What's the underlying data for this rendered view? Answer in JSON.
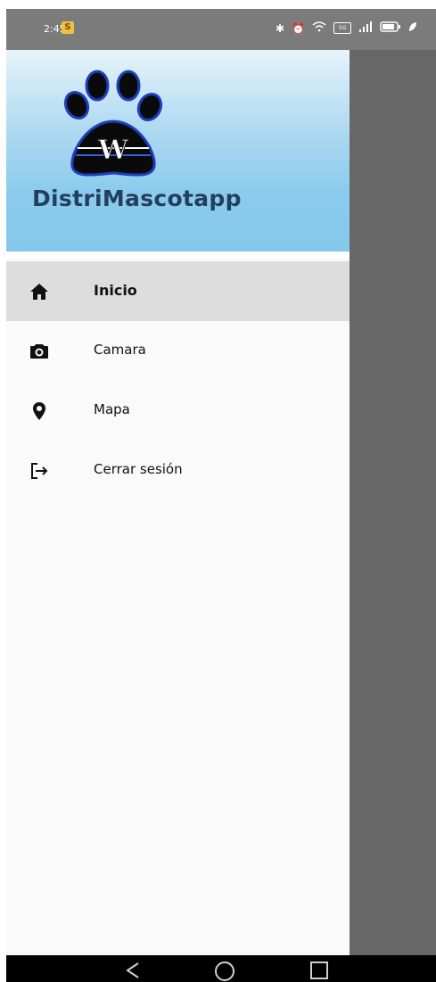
{
  "status_bar": {
    "time": "2:45",
    "notification_badge": "S",
    "data_label": "5G"
  },
  "drawer": {
    "app_name": "DistriMascotapp",
    "logo_letter": "W",
    "header_color": "#85c8eb",
    "menu": [
      {
        "label": "Inicio",
        "icon": "home-icon",
        "active": true
      },
      {
        "label": "Camara",
        "icon": "camera-icon",
        "active": false
      },
      {
        "label": "Mapa",
        "icon": "map-pin-icon",
        "active": false
      },
      {
        "label": "Cerrar sesión",
        "icon": "logout-icon",
        "active": false
      }
    ]
  },
  "nav_bar": {
    "buttons": [
      "back-icon",
      "home-circle-icon",
      "recents-icon"
    ]
  }
}
